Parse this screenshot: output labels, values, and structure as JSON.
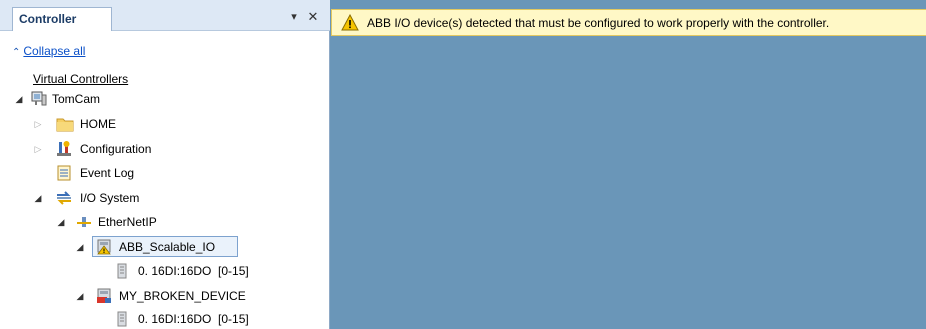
{
  "panel": {
    "title": "Controller",
    "pin_icon": "pin-icon",
    "close_icon": "close-icon",
    "collapse_label": "Collapse all"
  },
  "tree": {
    "root_label": "Virtual Controllers",
    "controller": "TomCam",
    "home": "HOME",
    "configuration": "Configuration",
    "event_log": "Event Log",
    "io_system": "I/O System",
    "ethernetip": "EtherNetIP",
    "device1": "ABB_Scalable_IO",
    "device1_signal": "0. 16DI:16DO  [0-15]",
    "device2": "MY_BROKEN_DEVICE",
    "device2_signal": "0. 16DI:16DO  [0-15]"
  },
  "warning": {
    "text": "ABB I/O device(s) detected that must be configured to work properly with the controller.",
    "icon": "warning-icon"
  },
  "colors": {
    "workspace_bg": "#6a96b8",
    "warning_bg": "#fff8c6",
    "header_bg": "#dde8f5"
  }
}
